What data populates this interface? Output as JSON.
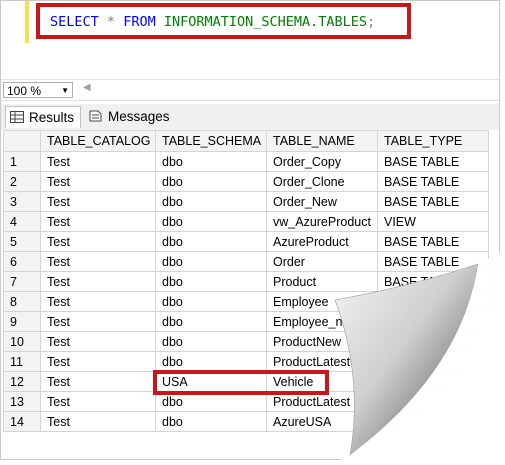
{
  "editor": {
    "sql": {
      "select": "SELECT",
      "star": "*",
      "from": "FROM",
      "target": "INFORMATION_SCHEMA.TABLES",
      "semicolon": ";"
    }
  },
  "zoom": {
    "value": "100 %"
  },
  "tabs": [
    {
      "label": "Results"
    },
    {
      "label": "Messages"
    }
  ],
  "grid": {
    "columns": [
      "TABLE_CATALOG",
      "TABLE_SCHEMA",
      "TABLE_NAME",
      "TABLE_TYPE"
    ],
    "rows": [
      {
        "n": "1",
        "catalog": "Test",
        "schema": "dbo",
        "name": "Order_Copy",
        "type": "BASE TABLE"
      },
      {
        "n": "2",
        "catalog": "Test",
        "schema": "dbo",
        "name": "Order_Clone",
        "type": "BASE TABLE"
      },
      {
        "n": "3",
        "catalog": "Test",
        "schema": "dbo",
        "name": "Order_New",
        "type": "BASE TABLE"
      },
      {
        "n": "4",
        "catalog": "Test",
        "schema": "dbo",
        "name": "vw_AzureProduct",
        "type": "VIEW"
      },
      {
        "n": "5",
        "catalog": "Test",
        "schema": "dbo",
        "name": "AzureProduct",
        "type": "BASE TABLE"
      },
      {
        "n": "6",
        "catalog": "Test",
        "schema": "dbo",
        "name": "Order",
        "type": "BASE TABLE"
      },
      {
        "n": "7",
        "catalog": "Test",
        "schema": "dbo",
        "name": "Product",
        "type": "BASE TABLE"
      },
      {
        "n": "8",
        "catalog": "Test",
        "schema": "dbo",
        "name": "Employee",
        "type": "BASE TABLE"
      },
      {
        "n": "9",
        "catalog": "Test",
        "schema": "dbo",
        "name": "Employee_n",
        "type": ""
      },
      {
        "n": "10",
        "catalog": "Test",
        "schema": "dbo",
        "name": "ProductNew",
        "type": ""
      },
      {
        "n": "11",
        "catalog": "Test",
        "schema": "dbo",
        "name": "ProductLatestC",
        "type": ""
      },
      {
        "n": "12",
        "catalog": "Test",
        "schema": "USA",
        "name": "Vehicle",
        "type": ""
      },
      {
        "n": "13",
        "catalog": "Test",
        "schema": "dbo",
        "name": "ProductLatest",
        "type": ""
      },
      {
        "n": "14",
        "catalog": "Test",
        "schema": "dbo",
        "name": "AzureUSA",
        "type": ""
      }
    ]
  },
  "colors": {
    "highlight": "#c8161d",
    "keyword": "#0000ff",
    "identifier": "#008000"
  }
}
